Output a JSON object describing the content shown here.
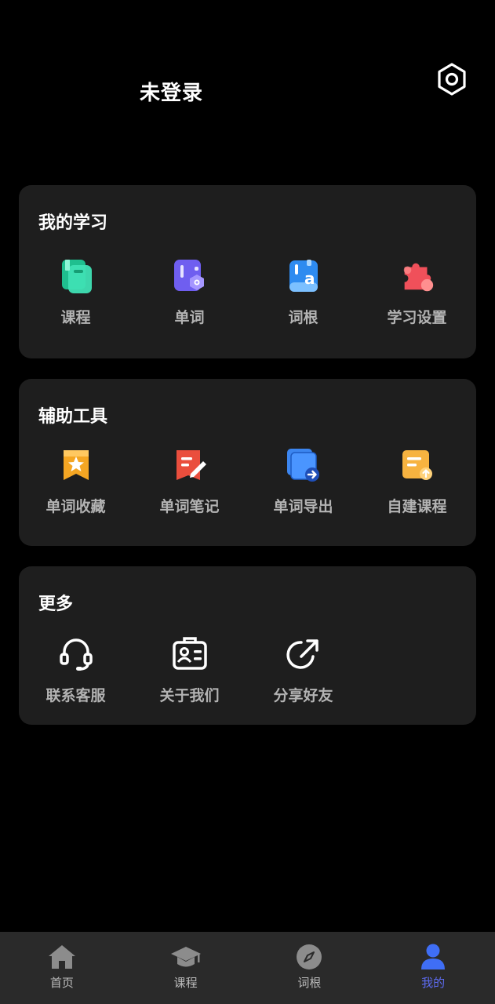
{
  "header": {
    "username": "未登录"
  },
  "sections": {
    "study": {
      "title": "我的学习",
      "items": [
        {
          "label": "课程",
          "icon": "course-book-icon"
        },
        {
          "label": "单词",
          "icon": "word-icon"
        },
        {
          "label": "词根",
          "icon": "word-root-icon"
        },
        {
          "label": "学习设置",
          "icon": "puzzle-icon"
        }
      ]
    },
    "tools": {
      "title": "辅助工具",
      "items": [
        {
          "label": "单词收藏",
          "icon": "star-bookmark-icon"
        },
        {
          "label": "单词笔记",
          "icon": "note-pen-icon"
        },
        {
          "label": "单词导出",
          "icon": "export-icon"
        },
        {
          "label": "自建课程",
          "icon": "custom-course-icon"
        }
      ]
    },
    "more": {
      "title": "更多",
      "items": [
        {
          "label": "联系客服",
          "icon": "headset-icon"
        },
        {
          "label": "关于我们",
          "icon": "id-badge-icon"
        },
        {
          "label": "分享好友",
          "icon": "share-icon"
        }
      ]
    }
  },
  "tabbar": {
    "items": [
      {
        "label": "首页",
        "icon": "home-icon"
      },
      {
        "label": "课程",
        "icon": "graduation-cap-icon"
      },
      {
        "label": "词根",
        "icon": "compass-icon"
      },
      {
        "label": "我的",
        "icon": "user-icon"
      }
    ],
    "active": "我的"
  },
  "colors": {
    "background": "#000000",
    "card": "#1e1e1e",
    "tabbar": "#2a2a2a",
    "accent": "#5d6bf0",
    "label": "#b3b3b3"
  }
}
